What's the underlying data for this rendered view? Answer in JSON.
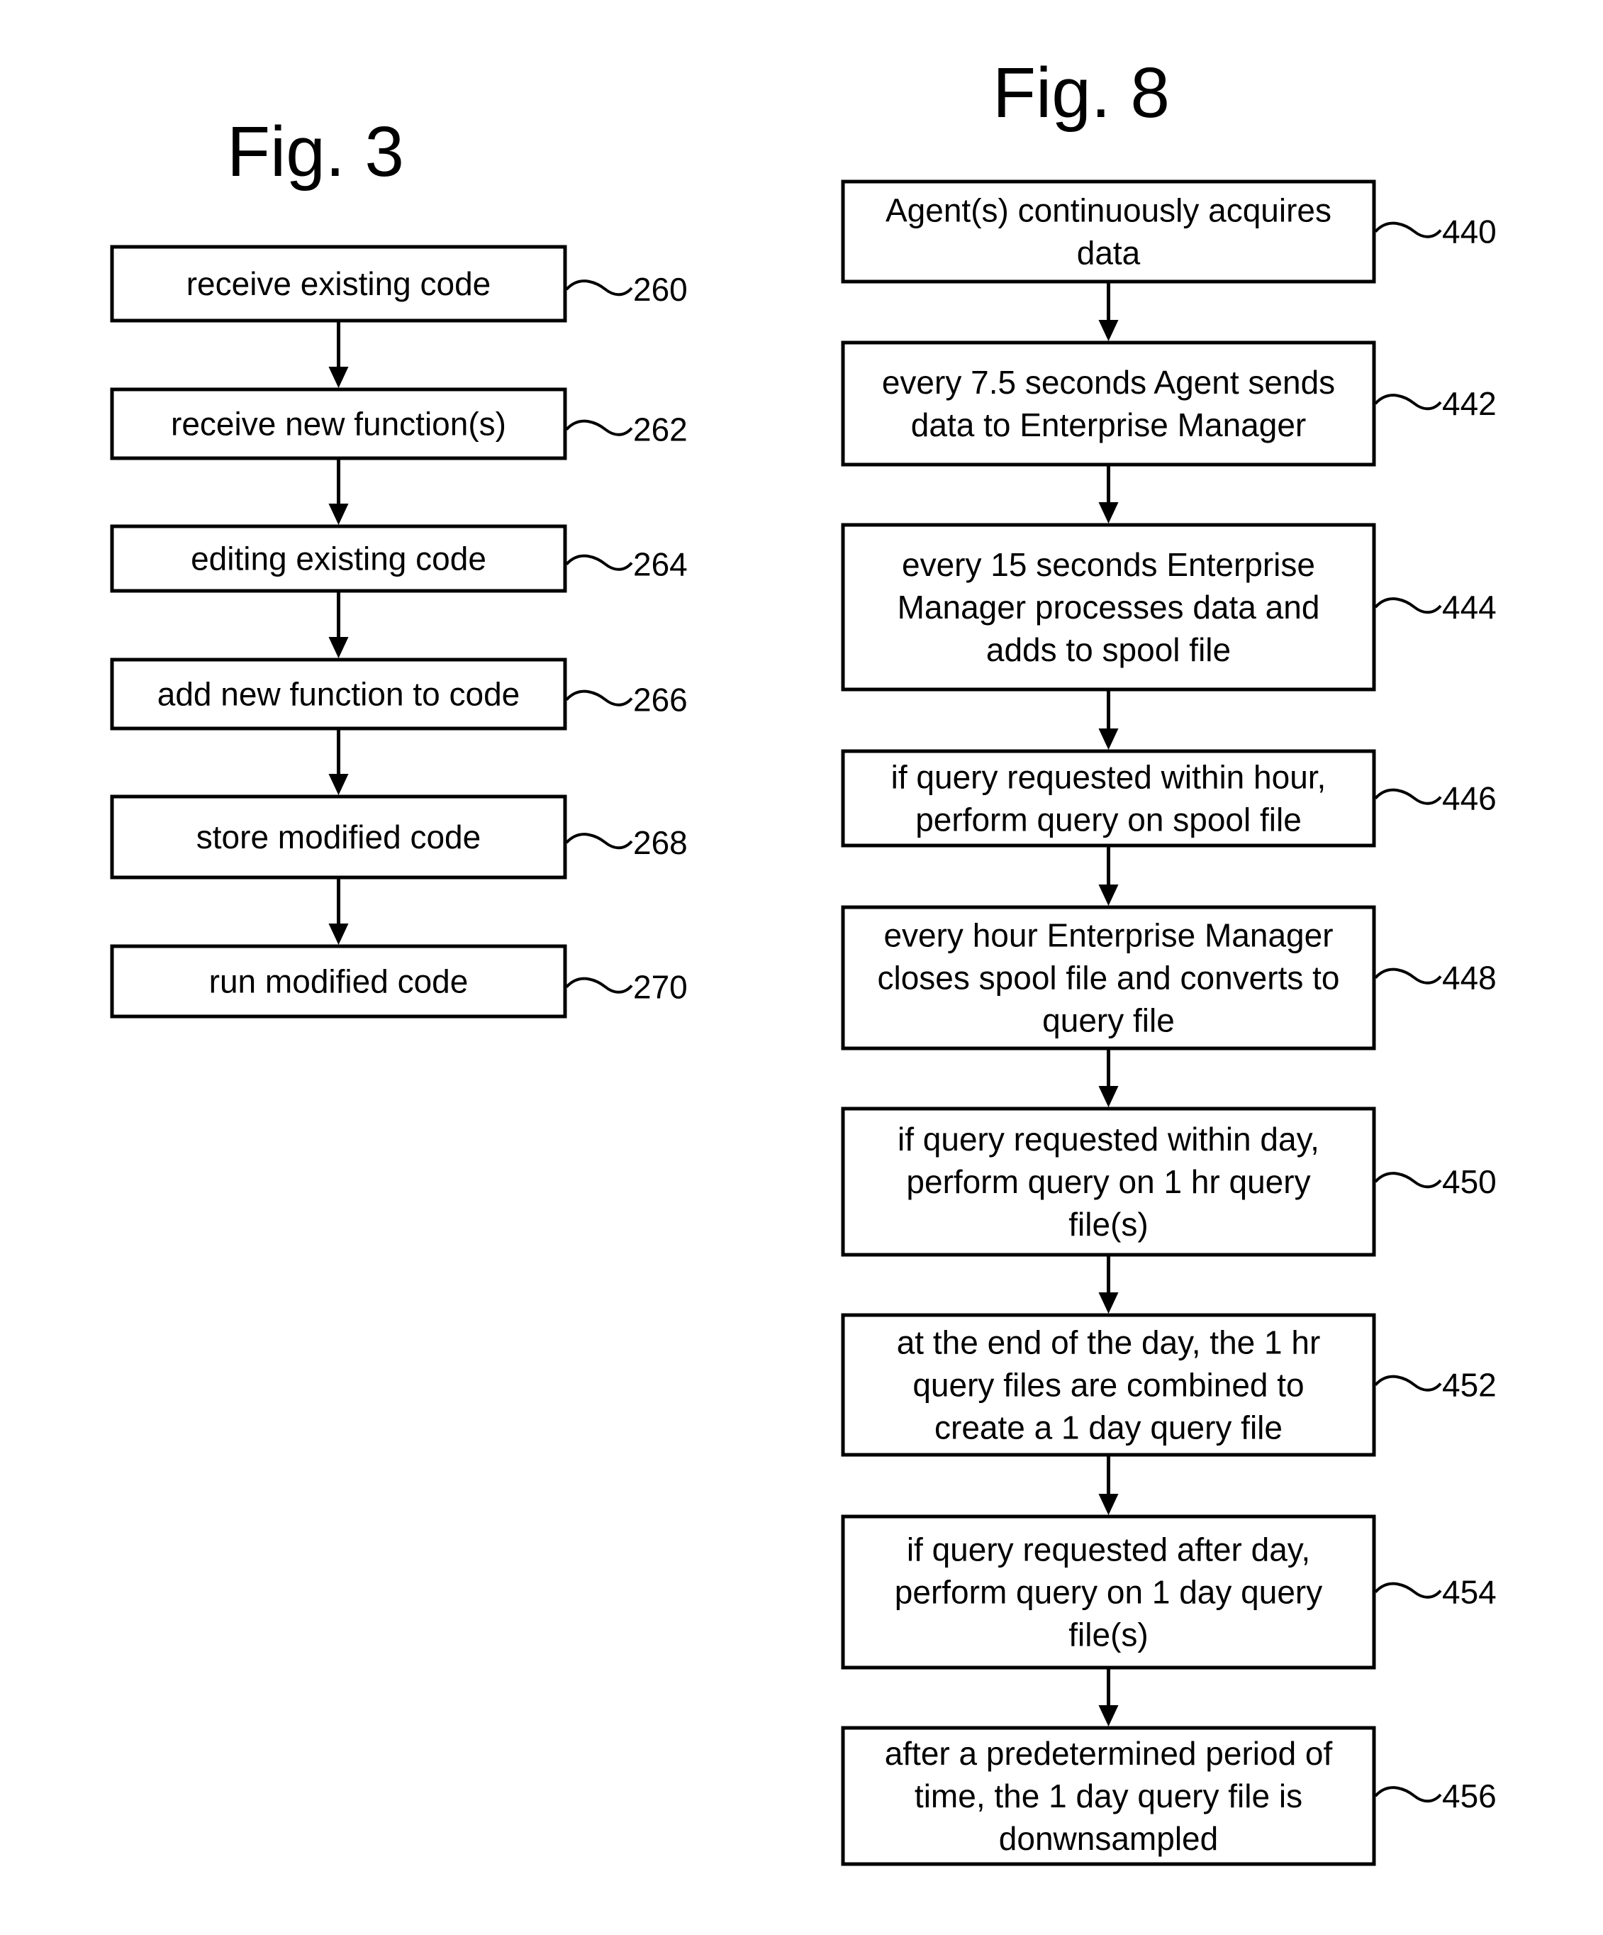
{
  "figures": [
    {
      "id": "fig3",
      "title": "Fig. 3",
      "steps": [
        {
          "ref": "260",
          "lines": [
            "receive existing code"
          ]
        },
        {
          "ref": "262",
          "lines": [
            "receive new function(s)"
          ]
        },
        {
          "ref": "264",
          "lines": [
            "editing existing code"
          ]
        },
        {
          "ref": "266",
          "lines": [
            "add new function to code"
          ]
        },
        {
          "ref": "268",
          "lines": [
            "store modified code"
          ]
        },
        {
          "ref": "270",
          "lines": [
            "run modified code"
          ]
        }
      ]
    },
    {
      "id": "fig8",
      "title": "Fig. 8",
      "steps": [
        {
          "ref": "440",
          "lines": [
            "Agent(s) continuously acquires",
            "data"
          ]
        },
        {
          "ref": "442",
          "lines": [
            "every 7.5 seconds Agent sends",
            "data to Enterprise Manager"
          ]
        },
        {
          "ref": "444",
          "lines": [
            "every 15 seconds Enterprise",
            "Manager processes data and",
            "adds to spool file"
          ]
        },
        {
          "ref": "446",
          "lines": [
            "if query requested within hour,",
            "perform query on spool file"
          ]
        },
        {
          "ref": "448",
          "lines": [
            "every hour Enterprise Manager",
            "closes spool file and converts to",
            "query file"
          ]
        },
        {
          "ref": "450",
          "lines": [
            "if query requested within day,",
            "perform query on 1 hr query",
            "file(s)"
          ]
        },
        {
          "ref": "452",
          "lines": [
            "at the end of the day, the 1 hr",
            "query files are combined to",
            "create a 1 day query file"
          ]
        },
        {
          "ref": "454",
          "lines": [
            "if query requested after day,",
            "perform query on 1 day query",
            "file(s)"
          ]
        },
        {
          "ref": "456",
          "lines": [
            "after a predetermined period of",
            "time, the 1 day query file is",
            "donwnsampled"
          ]
        }
      ]
    }
  ]
}
